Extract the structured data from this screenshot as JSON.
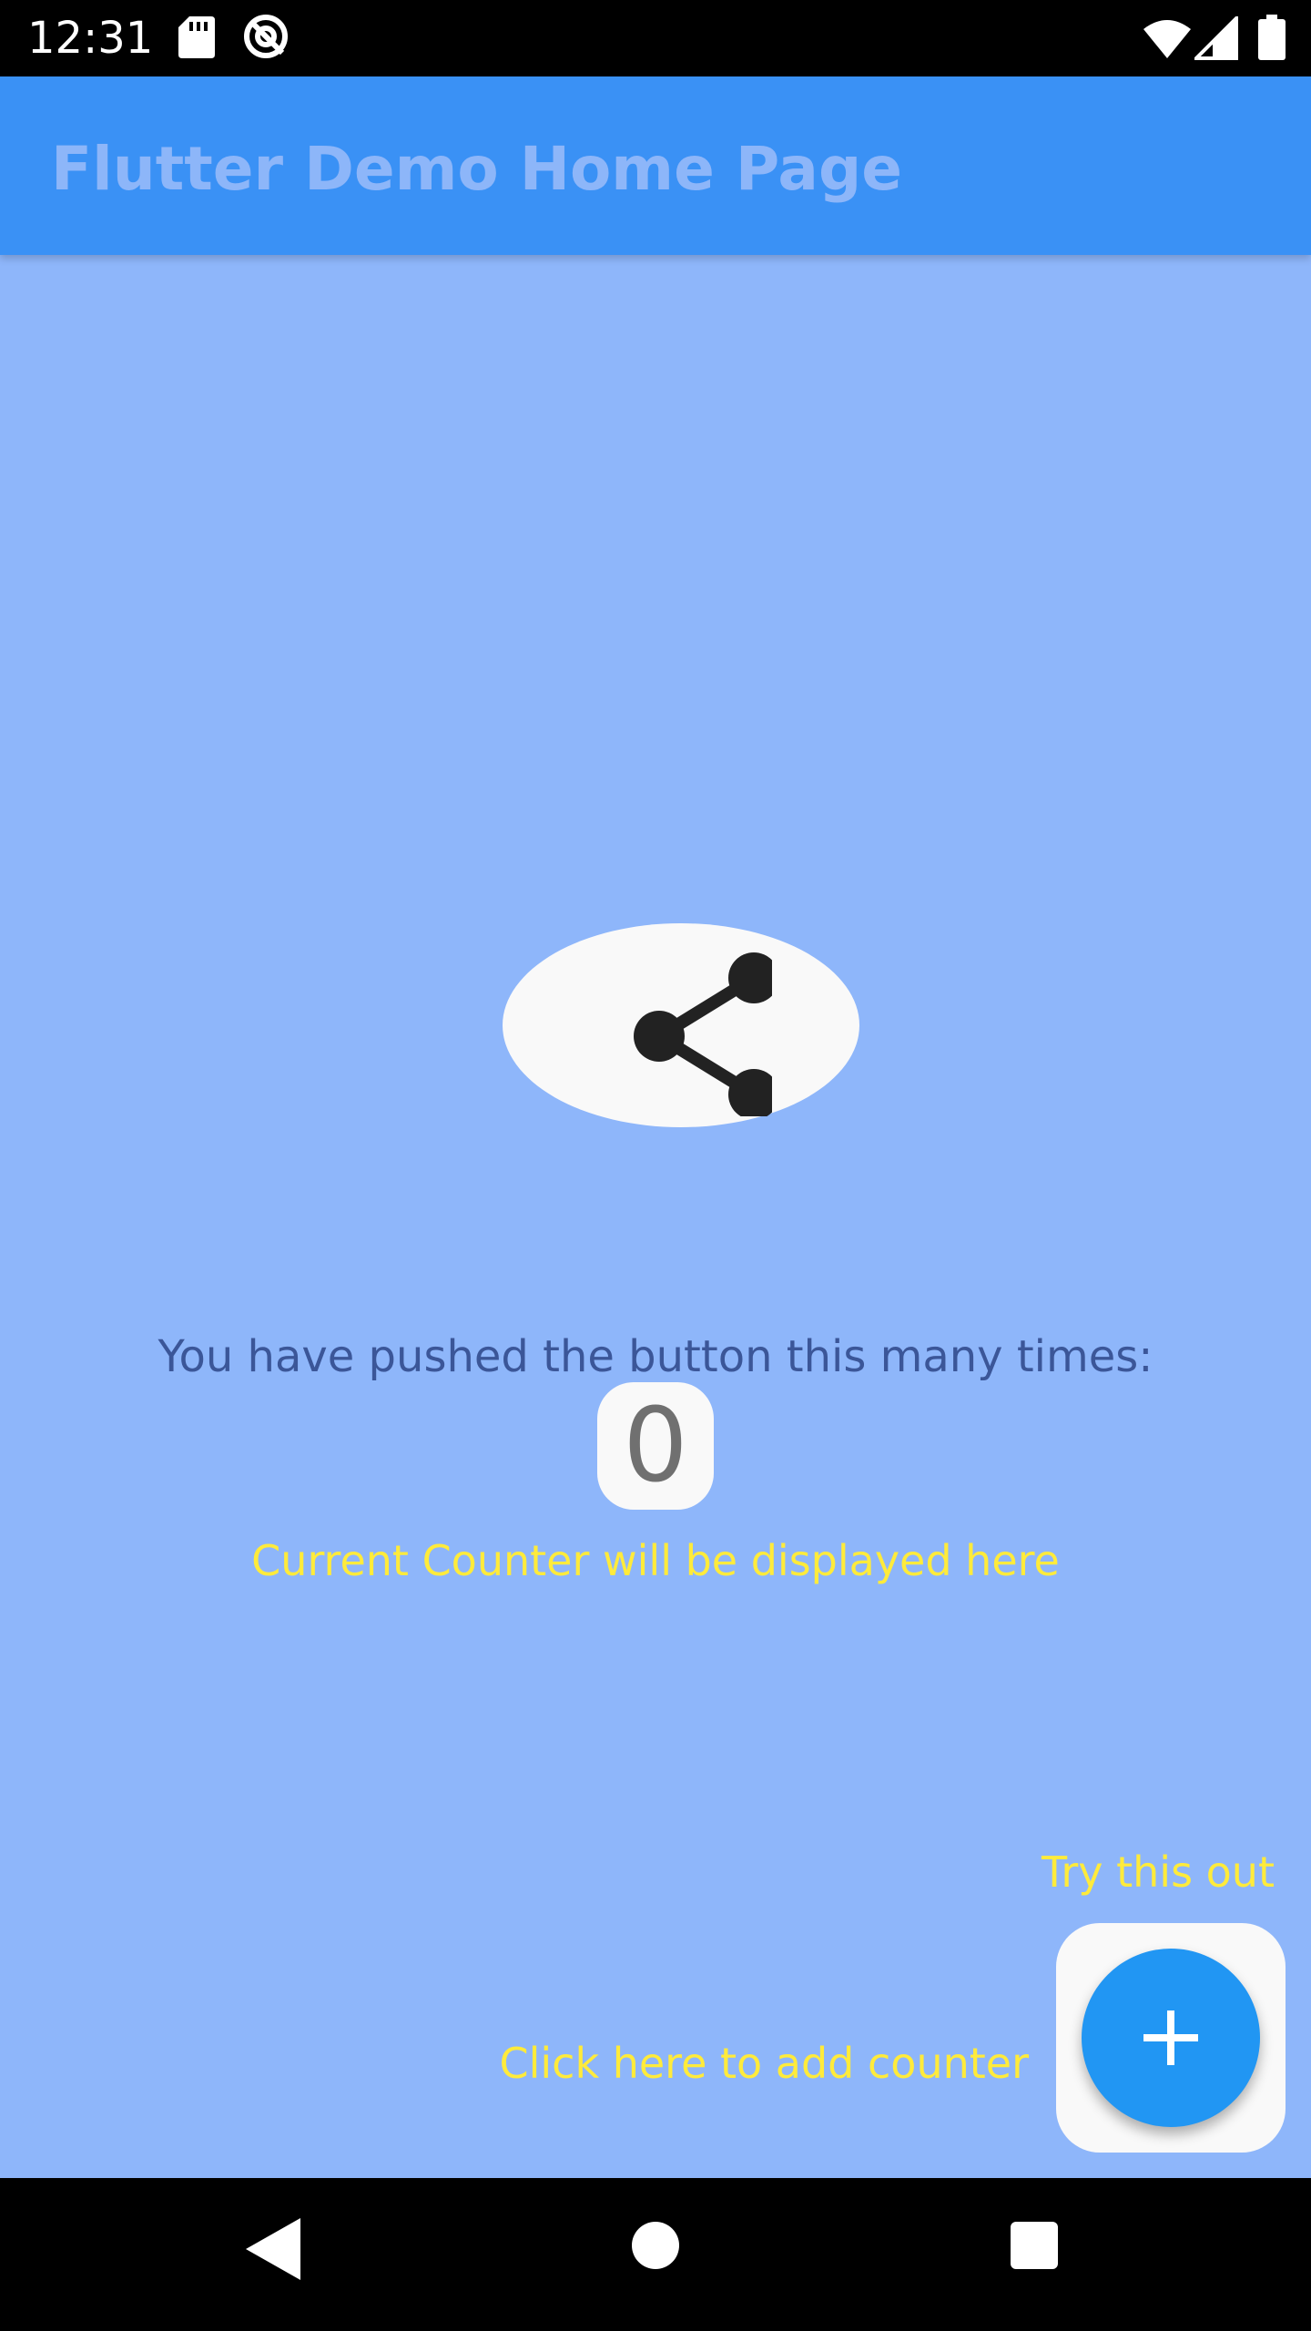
{
  "status_bar": {
    "time": "12:31",
    "icons": [
      "sd-card-icon",
      "sync-icon",
      "wifi-icon",
      "signal-icon",
      "battery-icon"
    ]
  },
  "app_bar": {
    "title": "Flutter Demo Home Page"
  },
  "main": {
    "share_icon": "share-icon",
    "push_label": "You have pushed the button this many times:",
    "counter_value": "0",
    "counter_caption": "Current Counter will be displayed here",
    "try_label": "Try this out",
    "click_label": "Click here to add counter",
    "fab_icon": "add-icon"
  },
  "nav_bar": {
    "icons": [
      "back-icon",
      "home-icon",
      "recents-icon"
    ]
  },
  "colors": {
    "app_bar": "#3a91f5",
    "app_bar_title": "#8db6f9",
    "background": "#8eb6fa",
    "push_label": "#3b5698",
    "hint_text": "#ffeb3b",
    "fab": "#2196f3",
    "card": "#f9f9f9"
  }
}
